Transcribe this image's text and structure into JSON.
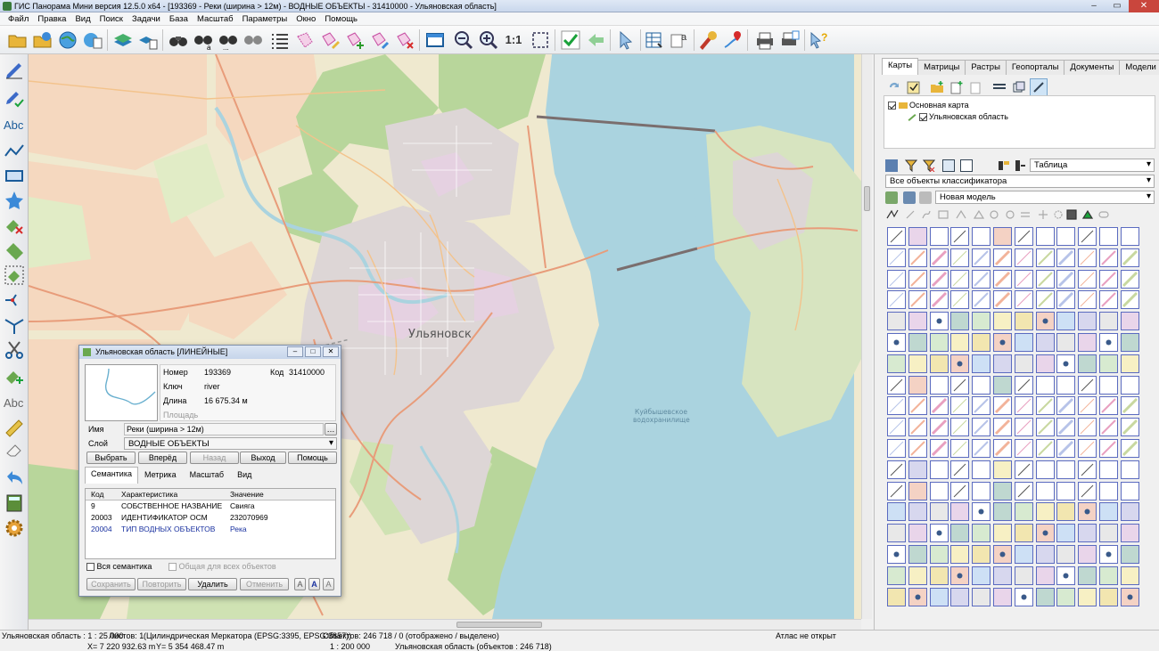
{
  "window": {
    "title": "ГИС Панорама Мини версия 12.5.0 x64 - [193369 - Реки (ширина > 12м) - ВОДНЫЕ ОБЪЕКТЫ - 31410000 - Ульяновская область]"
  },
  "menu": [
    "Файл",
    "Правка",
    "Вид",
    "Поиск",
    "Задачи",
    "База",
    "Масштаб",
    "Параметры",
    "Окно",
    "Помощь"
  ],
  "toolbar": {
    "zoom_label": "1:1"
  },
  "map": {
    "city_label": "Ульяновск",
    "reservoir_label_1": "Куйбышевское",
    "reservoir_label_2": "водохранилище"
  },
  "right_panel": {
    "tabs": [
      "Карты",
      "Матрицы",
      "Растры",
      "Геопорталы",
      "Документы",
      "Модели"
    ],
    "tree": {
      "root": "Основная карта",
      "child": "Ульяновская область"
    },
    "view_select": "Таблица",
    "classifier_select": "Все объекты классификатора",
    "model_select": "Новая модель"
  },
  "dialog": {
    "title": "Ульяновская область [ЛИНЕЙНЫЕ]",
    "number_label": "Номер",
    "number_value": "193369",
    "code_label": "Код",
    "code_value": "31410000",
    "key_label": "Ключ",
    "key_value": "river",
    "length_label": "Длина",
    "length_value": "16 675.34 м",
    "area_label": "Площадь",
    "name_label": "Имя",
    "name_value": "Реки (ширина > 12м)",
    "layer_label": "Слой",
    "layer_value": "ВОДНЫЕ ОБЪЕКТЫ",
    "buttons": {
      "select": "Выбрать",
      "forward": "Вперёд",
      "back": "Назад",
      "exit": "Выход",
      "help": "Помощь"
    },
    "tabs": [
      "Семантика",
      "Метрика",
      "Масштаб",
      "Вид"
    ],
    "table_headers": [
      "Код",
      "Характеристика",
      "Значение"
    ],
    "rows": [
      {
        "code": "9",
        "name": "СОБСТВЕННОЕ НАЗВАНИЕ",
        "value": "Свияга"
      },
      {
        "code": "20003",
        "name": "ИДЕНТИФИКАТОР ОСМ",
        "value": "232070969"
      },
      {
        "code": "20004",
        "name": "ТИП ВОДНЫХ ОБЪЕКТОВ",
        "value": "Река"
      }
    ],
    "all_semantics": "Вся семантика",
    "common_all": "Общая для всех объектов",
    "save": "Сохранить",
    "repeat": "Повторить",
    "delete": "Удалить",
    "cancel": "Отменить",
    "font_btn": "A"
  },
  "status": {
    "scale_info": "Ульяновская область : 1 : 25 000",
    "sheets": "Листов: 1",
    "projection": "(Цилиндрическая Меркатора (EPSG:3395, EPSG:3857))",
    "objects": "Объектов: 246 718 / 0 (отображено / выделено)",
    "atlas": "Атлас не открыт",
    "x_coord": "X= 7 220 932.63 m",
    "y_coord": "Y= 5 354 468.47 m",
    "current_scale": "1 : 200 000",
    "map_objects": "Ульяновская область   (объектов : 246 718)"
  }
}
